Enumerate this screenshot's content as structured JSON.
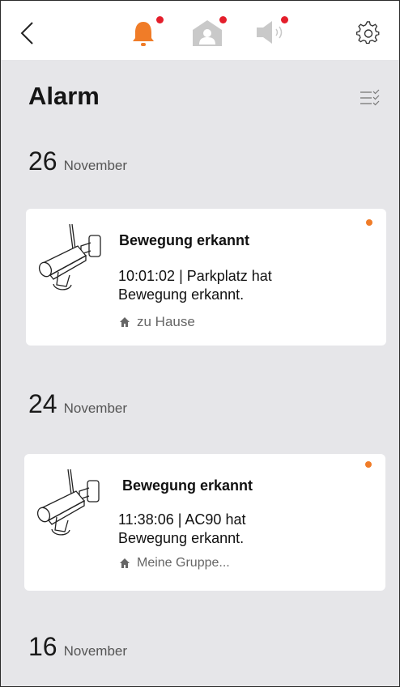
{
  "header": {
    "title": "Alarm",
    "icons": [
      "back-arrow-icon",
      "bell-icon",
      "home-person-icon",
      "speaker-icon",
      "gear-icon",
      "filter-list-icon"
    ]
  },
  "colors": {
    "accent_orange": "#f07c28",
    "notification_red": "#e41e2b",
    "background": "#e6e6e9"
  },
  "groups": [
    {
      "day": "26",
      "month": "November",
      "alarms": [
        {
          "title": "Bewegung erkannt",
          "description_line1": "10:01:02 | Parkplatz hat",
          "description_line2": "Bewegung erkannt.",
          "location": "zu Hause",
          "unread": true
        }
      ]
    },
    {
      "day": "24",
      "month": "November",
      "alarms": [
        {
          "title": "Bewegung erkannt",
          "description_line1": "11:38:06 | AC90 hat",
          "description_line2": "Bewegung erkannt.",
          "location": "Meine Gruppe...",
          "unread": true
        }
      ]
    },
    {
      "day": "16",
      "month": "November",
      "alarms": []
    }
  ]
}
